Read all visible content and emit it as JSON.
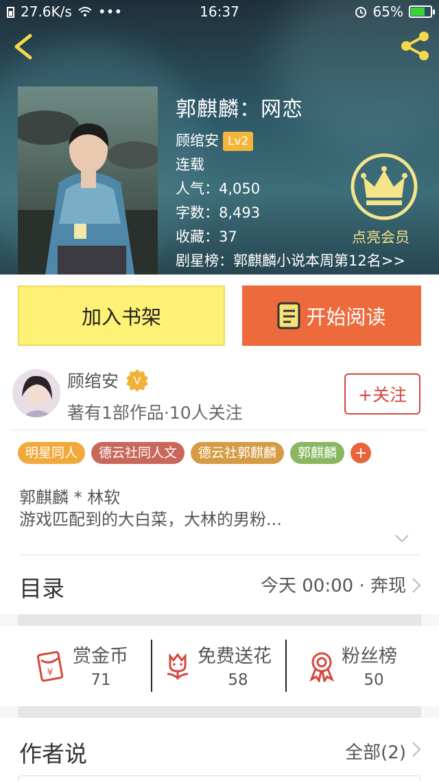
{
  "status_bar": {
    "speed": "27.6K/s",
    "time": "16:37",
    "battery": "65%",
    "battery_level": 0.65
  },
  "book": {
    "title": "郭麒麟：网恋",
    "author": "顾绾安",
    "level": "Lv2",
    "status": "连载",
    "popularity_label": "人气：",
    "popularity": "4,050",
    "words_label": "字数：",
    "words": "8,493",
    "favorites_label": "收藏：",
    "favorites": "37",
    "rank_label": "剧星榜：",
    "rank": "郭麒麟小说本周第12名>>"
  },
  "vip": {
    "label": "点亮会员"
  },
  "actions": {
    "shelf_label": "加入书架",
    "read_label": "开始阅读"
  },
  "author_card": {
    "name": "顾绾安",
    "meta": "著有1部作品·10人关注",
    "follow_label": "+关注"
  },
  "tags": [
    {
      "label": "明星同人",
      "color": "#f2a93b"
    },
    {
      "label": "德云社同人文",
      "color": "#c8675a"
    },
    {
      "label": "德云社郭麒麟",
      "color": "#d59c45"
    },
    {
      "label": "郭麒麟",
      "color": "#8ab760"
    }
  ],
  "tag_more": "+",
  "intro": {
    "line1": "郭麒麟 * 林软",
    "line2": "游戏匹配到的大白菜，大林的男粉..."
  },
  "toc": {
    "title": "目录",
    "info": "今天 00:00 · 奔现"
  },
  "stats": [
    {
      "label": "赏金币",
      "value": "71",
      "icon": "red-envelope-icon"
    },
    {
      "label": "免费送花",
      "value": "58",
      "icon": "flower-icon"
    },
    {
      "label": "粉丝榜",
      "value": "50",
      "icon": "medal-icon"
    }
  ],
  "author_says": {
    "title": "作者说",
    "more": "全部(2)"
  },
  "colors": {
    "accent": "#ec6a3b",
    "shelf": "#fdf176",
    "follow": "#d6463b",
    "vip": "#f4e48a"
  }
}
